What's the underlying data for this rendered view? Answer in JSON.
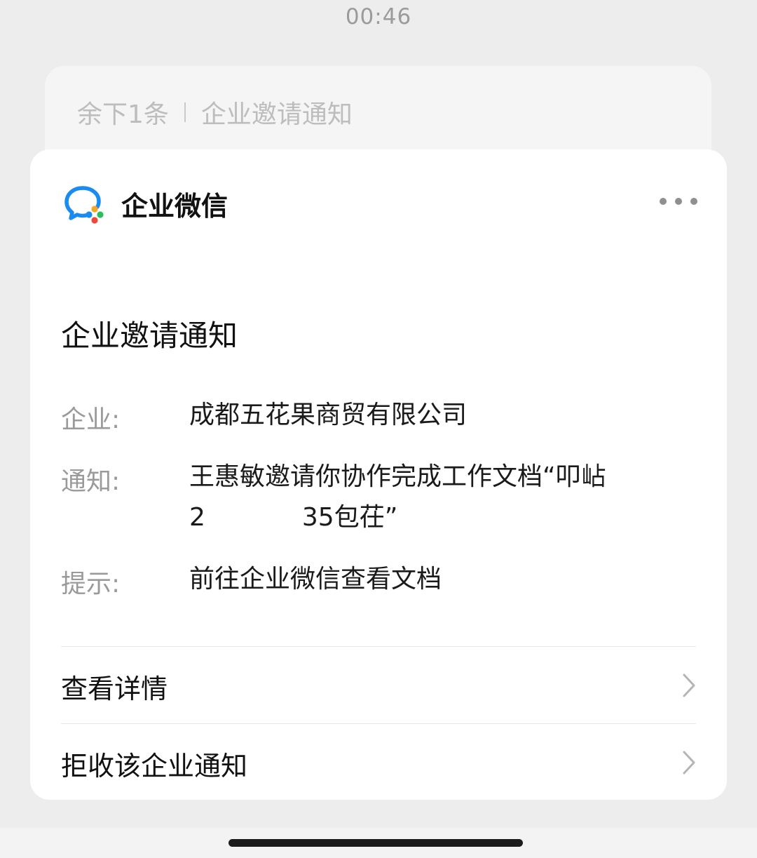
{
  "status_bar": {
    "time": "00:46"
  },
  "stacked_notice": {
    "remaining": "余下1条",
    "title": "企业邀请通知"
  },
  "app": {
    "name": "企业微信",
    "icon": "wecom-logo-icon",
    "more_icon": "more-dots-icon"
  },
  "notice": {
    "title": "企业邀请通知",
    "fields": [
      {
        "label": "企业:",
        "lines": [
          "成都五花果商贸有限公司"
        ]
      },
      {
        "label": "通知:",
        "lines": [
          "王惠敏邀请你协作完成工作文档“叩岾",
          "2",
          "35包茌”"
        ]
      },
      {
        "label": "提示:",
        "lines": [
          "前往企业微信查看文档"
        ]
      }
    ]
  },
  "actions": [
    {
      "label": "查看详情",
      "icon": "chevron-right-icon"
    },
    {
      "label": "拒收该企业通知",
      "icon": "chevron-right-icon"
    }
  ],
  "colors": {
    "background": "#ededed",
    "card": "#ffffff",
    "logo_blue": "#1a8bf0",
    "logo_green": "#2bbf5c",
    "logo_orange": "#f5a623",
    "logo_red": "#f0473c"
  }
}
